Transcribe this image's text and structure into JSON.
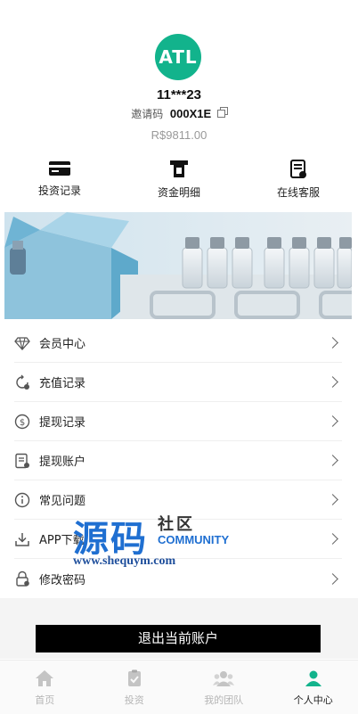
{
  "profile": {
    "avatar_text": "ATL",
    "username": "11***23",
    "invite_label": "邀请码",
    "invite_code": "000X1E",
    "balance": "R$9811.00"
  },
  "quick_actions": [
    {
      "label": "投资记录",
      "icon": "card-icon"
    },
    {
      "label": "资金明细",
      "icon": "atm-icon"
    },
    {
      "label": "在线客服",
      "icon": "document-icon"
    }
  ],
  "menu": [
    {
      "label": "会员中心",
      "icon": "diamond-icon"
    },
    {
      "label": "充值记录",
      "icon": "recharge-icon"
    },
    {
      "label": "提现记录",
      "icon": "dollar-coin-icon"
    },
    {
      "label": "提现账户",
      "icon": "account-list-icon"
    },
    {
      "label": "常见问题",
      "icon": "info-icon"
    },
    {
      "label": "APP下载",
      "icon": "download-icon"
    },
    {
      "label": "修改密码",
      "icon": "lock-icon"
    }
  ],
  "watermark": {
    "big": "源码",
    "small": "社区",
    "community": "COMMUNITY",
    "url": "www.shequym.com"
  },
  "logout_label": "退出当前账户",
  "tabs": [
    {
      "label": "首页",
      "icon": "home-icon",
      "active": false
    },
    {
      "label": "投资",
      "icon": "clipboard-check-icon",
      "active": false
    },
    {
      "label": "我的团队",
      "icon": "team-icon",
      "active": false
    },
    {
      "label": "个人中心",
      "icon": "person-icon",
      "active": true
    }
  ],
  "colors": {
    "accent": "#12b38c",
    "tab_inactive": "#b5b5b5",
    "logout_bg": "#000000"
  }
}
